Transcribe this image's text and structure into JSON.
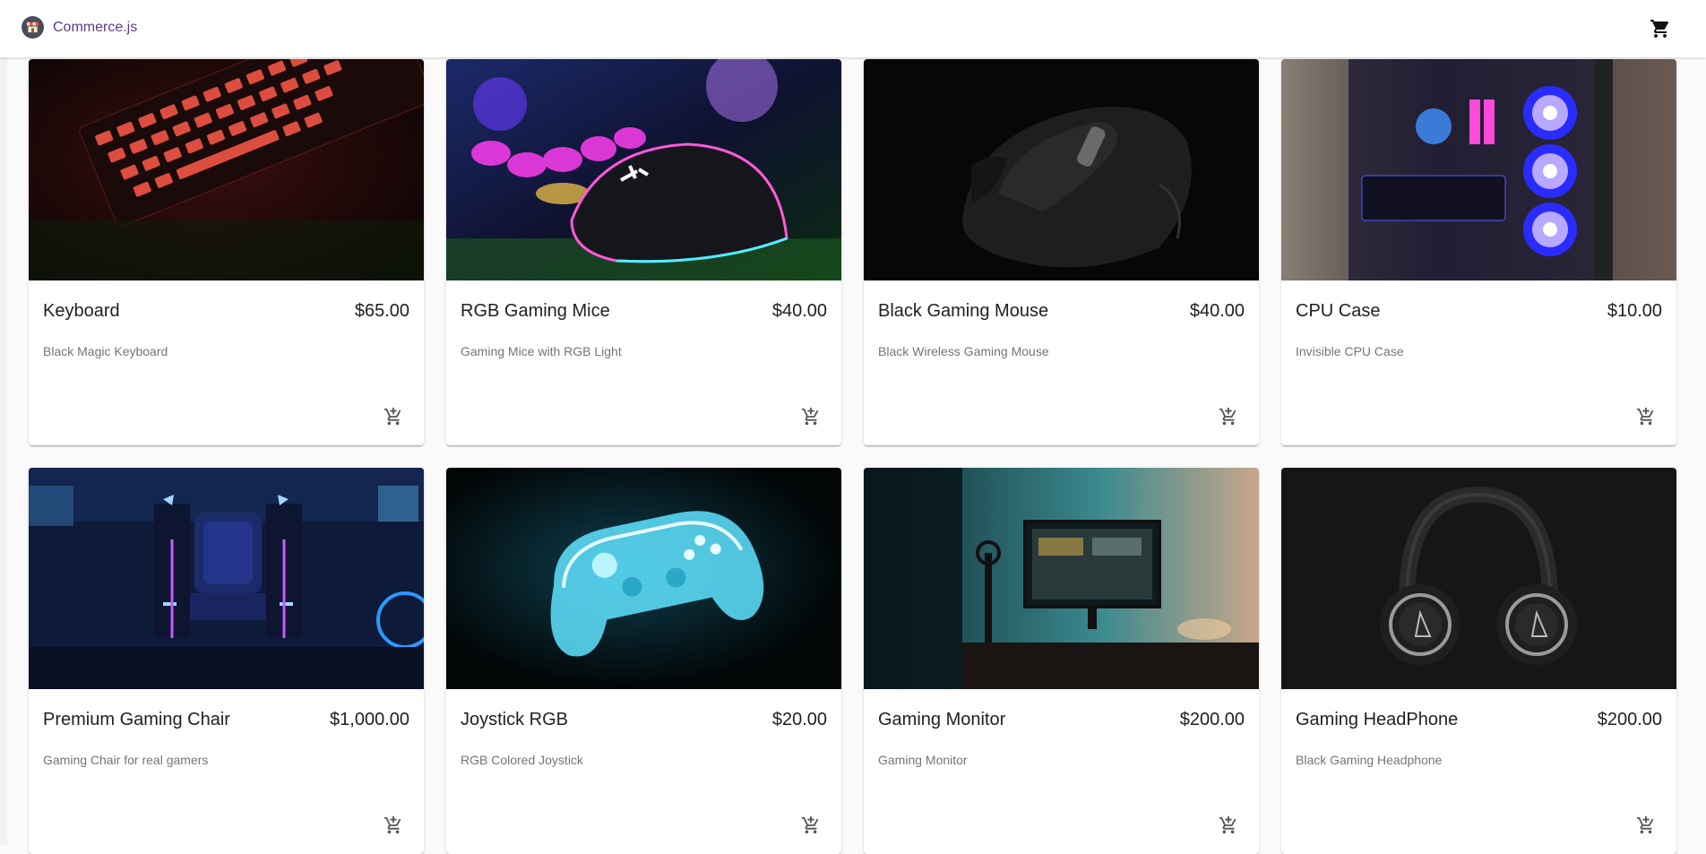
{
  "header": {
    "brand_name": "Commerce.js",
    "logo_icon": "store-icon",
    "cart_icon": "shopping-cart-icon"
  },
  "products": [
    {
      "name": "Keyboard",
      "price": "$65.00",
      "description": "Black Magic Keyboard",
      "image": "red-backlit-keyboard"
    },
    {
      "name": "RGB Gaming Mice",
      "price": "$40.00",
      "description": "Gaming Mice with RGB Light",
      "image": "rgb-mouse-on-neon-background"
    },
    {
      "name": "Black Gaming Mouse",
      "price": "$40.00",
      "description": "Black Wireless Gaming Mouse",
      "image": "black-wireless-mouse"
    },
    {
      "name": "CPU Case",
      "price": "$10.00",
      "description": "Invisible CPU Case",
      "image": "glass-pc-case-blue-fans"
    },
    {
      "name": "Premium Gaming Chair",
      "price": "$1,000.00",
      "description": "Gaming Chair for real gamers",
      "image": "neon-gaming-chairs"
    },
    {
      "name": "Joystick RGB",
      "price": "$20.00",
      "description": "RGB Colored Joystick",
      "image": "glowing-blue-gamepad"
    },
    {
      "name": "Gaming Monitor",
      "price": "$200.00",
      "description": "Gaming Monitor",
      "image": "monitor-on-desk-teal-light"
    },
    {
      "name": "Gaming HeadPhone",
      "price": "$200.00",
      "description": "Black Gaming Headphone",
      "image": "black-headphones"
    }
  ],
  "add_to_cart_icon": "add-shopping-cart-icon",
  "colors": {
    "brand_text": "#5c3b8a",
    "text_primary": "#212121",
    "text_secondary": "#757575",
    "background": "#fafafa"
  }
}
